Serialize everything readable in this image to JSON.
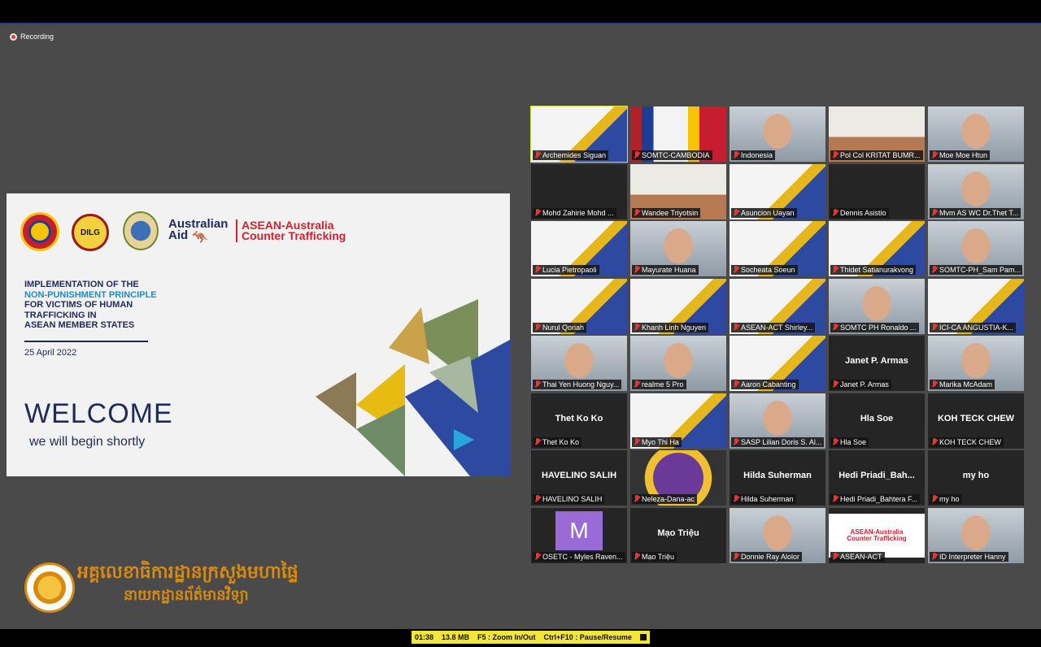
{
  "recording": {
    "label": "Recording"
  },
  "slide": {
    "logos": {
      "dilg": "DILG"
    },
    "aus_aid": [
      "Australian",
      "Aid"
    ],
    "asean_act": [
      "ASEAN-Australia",
      "Counter Trafficking"
    ],
    "title_line1": "IMPLEMENTATION OF THE",
    "title_highlight": "NON-PUNISHMENT PRINCIPLE",
    "title_line3": "FOR VICTIMS OF HUMAN",
    "title_line4": "TRAFFICKING IN",
    "title_line5": "ASEAN MEMBER STATES",
    "date": "25 April 2022",
    "welcome": "WELCOME",
    "subtitle": "we will begin shortly"
  },
  "footer": {
    "khmer_line1": "អគ្គលេខាធិការដ្ឋានក្រសួងមហាផ្ទៃ",
    "khmer_line2": "នាយកដ្ឋានព័ត៌មានវិទ្យា"
  },
  "participants": [
    {
      "name": "Archemides Siguan",
      "video": "slide",
      "active": true
    },
    {
      "name": "SOMTC-CAMBODIA",
      "video": "flags"
    },
    {
      "name": "Indonesia",
      "video": "person"
    },
    {
      "name": "Pol Col KRITAT BUMR...",
      "video": "room"
    },
    {
      "name": "Moe Moe Htun",
      "video": "person"
    },
    {
      "name": "Mohd Zahirie Mohd ...",
      "video": "none"
    },
    {
      "name": "Wandee Triyotsin",
      "video": "room"
    },
    {
      "name": "Asuncion Uayan",
      "video": "slide"
    },
    {
      "name": "Dennis Asistio",
      "video": "none"
    },
    {
      "name": "Mvm AS WC Dr.Thet T...",
      "video": "person"
    },
    {
      "name": "Lucia Pietropaoli",
      "video": "slide"
    },
    {
      "name": "Mayurate Huana",
      "video": "person"
    },
    {
      "name": "Socheata Soeun",
      "video": "slide"
    },
    {
      "name": "Thidet Satianurakvong",
      "video": "slide"
    },
    {
      "name": "SOMTC-PH_Sam Pam...",
      "video": "person"
    },
    {
      "name": "Nurul Qoriah",
      "video": "slide"
    },
    {
      "name": "Khanh Linh Nguyen",
      "video": "slide"
    },
    {
      "name": "ASEAN-ACT Shirley...",
      "video": "slide"
    },
    {
      "name": "SOMTC PH Ronaldo ...",
      "video": "person"
    },
    {
      "name": "ICI-CA ANGUSTIA-K...",
      "video": "slide"
    },
    {
      "name": "Thai Yen Huong Nguy...",
      "video": "person"
    },
    {
      "name": "realme 5 Pro",
      "video": "person"
    },
    {
      "name": "Aaron Cabanting",
      "video": "slide"
    },
    {
      "name": "Janet P. Armas",
      "video": "none",
      "big": "Janet P. Armas"
    },
    {
      "name": "Marika McAdam",
      "video": "person"
    },
    {
      "name": "Thet Ko Ko",
      "video": "none",
      "big": "Thet Ko Ko"
    },
    {
      "name": "Myo Thi Ha",
      "video": "slide"
    },
    {
      "name": "SASP Lilian Doris S. Al...",
      "video": "person"
    },
    {
      "name": "Hla Soe",
      "video": "none",
      "big": "Hla Soe"
    },
    {
      "name": "KOH TECK CHEW",
      "video": "none",
      "big": "KOH TECK CHEW"
    },
    {
      "name": "HAVELINO SALIH",
      "video": "none",
      "big": "HAVELINO SALIH"
    },
    {
      "name": "Neleza-Dana-ac",
      "video": "emblem"
    },
    {
      "name": "Hilda Suherman",
      "video": "none",
      "big": "Hilda Suherman"
    },
    {
      "name": "Hedi Priadi_Bahtera F...",
      "video": "none",
      "big": "Hedi  Priadi_Bah..."
    },
    {
      "name": "my ho",
      "video": "none",
      "big": "my ho"
    },
    {
      "name": "OSETC - Myles Raven...",
      "video": "avatar",
      "avatar_letter": "M"
    },
    {
      "name": "Mạo Triệu",
      "video": "none",
      "big": "Mạo Triệu"
    },
    {
      "name": "Donnie Ray Alolor",
      "video": "person"
    },
    {
      "name": "ASEAN-ACT",
      "video": "logo"
    },
    {
      "name": "ID Interpreter Hanny",
      "video": "person"
    }
  ],
  "status": {
    "time": "01:38",
    "size": "13.8 MB",
    "zoom": "F5 : Zoom In/Out",
    "pause": "Ctrl+F10 : Pause/Resume"
  }
}
